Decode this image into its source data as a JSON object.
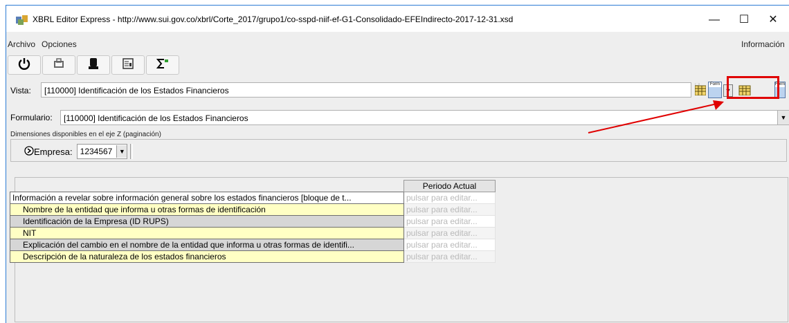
{
  "window": {
    "title": "XBRL Editor Express - http://www.sui.gov.co/xbrl/Corte_2017/grupo1/co-sspd-niif-ef-G1-Consolidado-EFEIndirecto-2017-12-31.xsd",
    "minimize": "—",
    "maximize": "☐",
    "close": "✕"
  },
  "menu": {
    "archivo": "Archivo",
    "opciones": "Opciones",
    "informacion": "Información"
  },
  "toolbar": [
    "power-icon",
    "print-icon",
    "save-icon",
    "form-icon",
    "sigma-icon"
  ],
  "vista": {
    "label": "Vista:",
    "value": "[110000] Identificación de los Estados Financieros",
    "form_badge_1": "Form",
    "form_badge_2": "Form"
  },
  "formulario": {
    "label": "Formulario:",
    "value": "[110000] Identificación de los Estados Financieros"
  },
  "dimensiones": {
    "label": "Dimensiones disponibles en el eje Z (paginación)",
    "empresa_label": "Empresa:",
    "empresa_value": "1234567"
  },
  "table": {
    "column_header": "Periodo Actual",
    "placeholder": "pulsar para editar...",
    "rows": [
      {
        "label": "Información a revelar sobre información general sobre los estados financieros [bloque de t..."
      },
      {
        "label": "Nombre de la entidad que informa u otras formas de identificación"
      },
      {
        "label": "Identificación de la Empresa (ID RUPS)"
      },
      {
        "label": "NIT"
      },
      {
        "label": "Explicación del cambio en el nombre de la entidad que informa u otras formas de identifi..."
      },
      {
        "label": "Descripción de la naturaleza de los estados financieros"
      }
    ]
  },
  "colors": {
    "highlight": "#e00000",
    "row_yellow": "#ffffc4",
    "row_gray": "#d6d6d6"
  }
}
